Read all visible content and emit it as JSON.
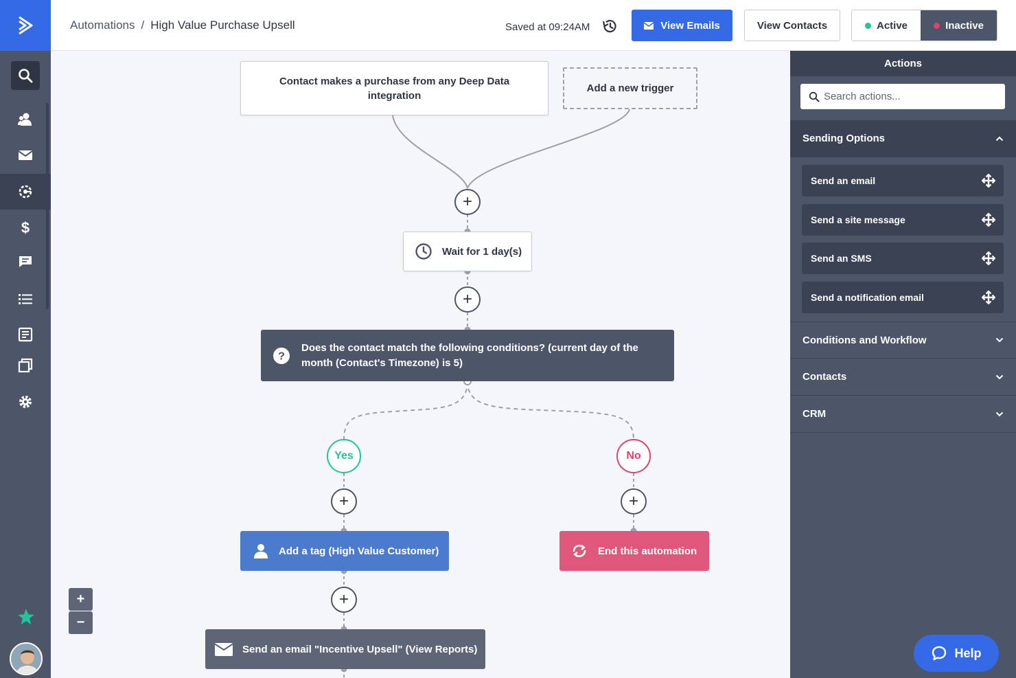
{
  "header": {
    "breadcrumb_root": "Automations",
    "breadcrumb_separator": "/",
    "automation_name": "High Value Purchase Upsell",
    "saved_status": "Saved at 09:24AM",
    "view_emails_label": "View Emails",
    "view_contacts_label": "View Contacts",
    "active_label": "Active",
    "inactive_label": "Inactive"
  },
  "nav": {
    "items": [
      "search-icon",
      "contacts-icon",
      "campaigns-icon",
      "automations-icon",
      "deals-icon",
      "conversations-icon",
      "lists-icon",
      "forms-icon",
      "pages-icon",
      "settings-icon"
    ]
  },
  "flow": {
    "trigger_main": "Contact makes a purchase from any Deep Data integration",
    "trigger_new": "Add a new trigger",
    "wait": "Wait for 1 day(s)",
    "condition": "Does the contact match the following conditions? (current day of the month (Contact's Timezone) is 5)",
    "yes_label": "Yes",
    "no_label": "No",
    "tag_action": "Add a tag (High Value Customer)",
    "end_action": "End this automation",
    "email_action": "Send an email \"Incentive Upsell\" (View Reports)"
  },
  "panel": {
    "title": "Actions",
    "search_placeholder": "Search actions...",
    "sections": [
      {
        "label": "Sending Options",
        "expanded": true
      },
      {
        "label": "Conditions and Workflow",
        "expanded": false
      },
      {
        "label": "Contacts",
        "expanded": false
      },
      {
        "label": "CRM",
        "expanded": false
      }
    ],
    "sending_actions": [
      "Send an email",
      "Send a site message",
      "Send an SMS",
      "Send a notification email"
    ]
  },
  "help_label": "Help",
  "colors": {
    "brand_blue": "#356ae6",
    "nav_bg": "#4d5568",
    "active_green": "#1fc59b",
    "inactive_red": "#e3416d",
    "tag_blue": "#4b7bcc",
    "end_pink": "#e0577c"
  }
}
